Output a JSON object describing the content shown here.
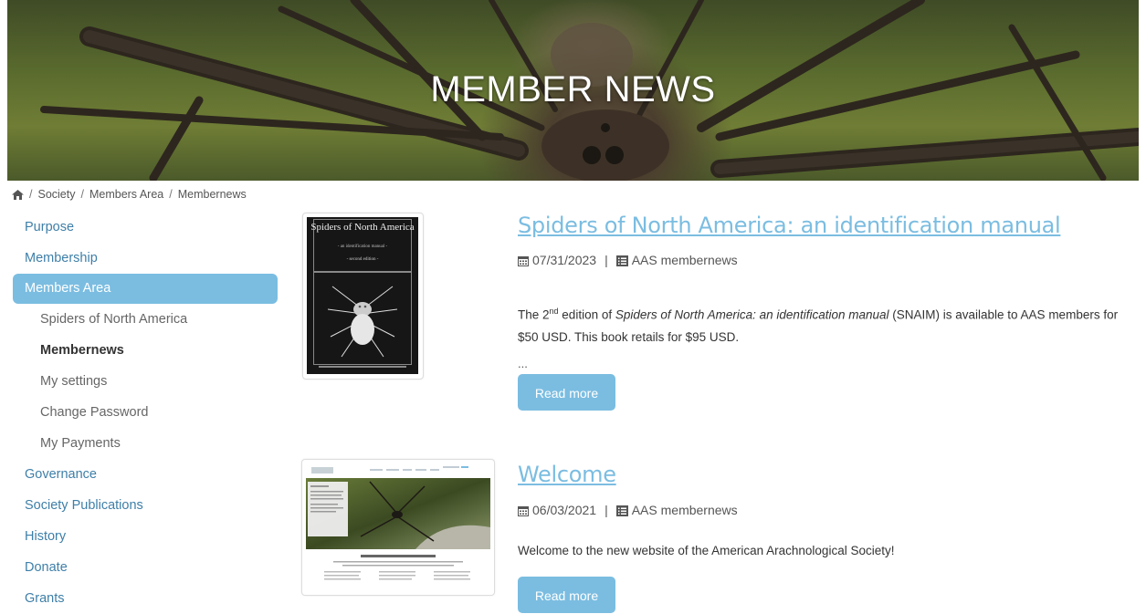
{
  "banner": {
    "title": "MEMBER NEWS"
  },
  "breadcrumb": {
    "items": [
      "Society",
      "Members Area",
      "Membernews"
    ]
  },
  "sidebar": {
    "items": [
      {
        "label": "Purpose"
      },
      {
        "label": "Membership"
      },
      {
        "label": "Members Area"
      },
      {
        "label": "Spiders of North America"
      },
      {
        "label": "Membernews"
      },
      {
        "label": "My settings"
      },
      {
        "label": "Change Password"
      },
      {
        "label": "My Payments"
      },
      {
        "label": "Governance"
      },
      {
        "label": "Society Publications"
      },
      {
        "label": "History"
      },
      {
        "label": "Donate"
      },
      {
        "label": "Grants"
      }
    ]
  },
  "articles": [
    {
      "title": "Spiders of North America: an identification manual",
      "date": "07/31/2023",
      "category": "AAS membernews",
      "excerpt_pre": "The 2",
      "excerpt_sup": "nd",
      "excerpt_mid": " edition of ",
      "excerpt_italic": "Spiders of North America: an identification manual",
      "excerpt_post": " (SNAIM) is available to AAS members for $50 USD. This book retails for $95 USD.",
      "ellipsis": "...",
      "read_more": "Read more",
      "cover": {
        "title": "Spiders of North America",
        "subtitle": "- an identification manual -",
        "edition": "- second edition -"
      }
    },
    {
      "title": "Welcome",
      "date": "06/03/2021",
      "category": "AAS membernews",
      "excerpt": "Welcome to the new website of the American Arachnological Society!",
      "read_more": "Read more"
    }
  ],
  "colors": {
    "accent": "#7bbde1",
    "link": "#3e7fa8"
  },
  "icons": {
    "home": "home-icon",
    "date": "calendar-icon",
    "category": "list-icon"
  }
}
